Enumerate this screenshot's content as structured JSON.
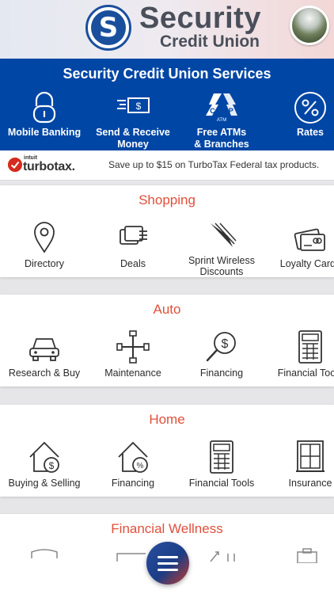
{
  "header": {
    "logo_letter": "S",
    "logo_title": "Security",
    "logo_subtitle": "Credit Union"
  },
  "services": {
    "title": "Security Credit Union Services",
    "items": [
      {
        "label": "Mobile Banking",
        "icon": "lock-icon"
      },
      {
        "label": "Send & Receive\nMoney",
        "icon": "money-transfer-icon"
      },
      {
        "label": "Free ATMs\n& Branches",
        "icon": "co-op-atm-icon"
      },
      {
        "label": "Rates",
        "icon": "percent-icon"
      }
    ],
    "coop_text": "CO-OP",
    "coop_sub": "ATM"
  },
  "promo": {
    "brand_small": "intuit",
    "brand": "turbotax.",
    "text": "Save up to $15 on TurboTax Federal tax products."
  },
  "sections": {
    "shopping": {
      "title": "Shopping",
      "items": [
        "Directory",
        "Deals",
        "Sprint Wireless\nDiscounts",
        "Loyalty Cards"
      ]
    },
    "auto": {
      "title": "Auto",
      "items": [
        "Research & Buy",
        "Maintenance",
        "Financing",
        "Financial Tools"
      ]
    },
    "home": {
      "title": "Home",
      "items": [
        "Buying & Selling",
        "Financing",
        "Financial Tools",
        "Insurance"
      ]
    },
    "wellness": {
      "title": "Financial Wellness"
    }
  },
  "colors": {
    "brand_blue": "#0046a5",
    "section_title": "#e0503a",
    "turbotax_red": "#d52b1e"
  }
}
